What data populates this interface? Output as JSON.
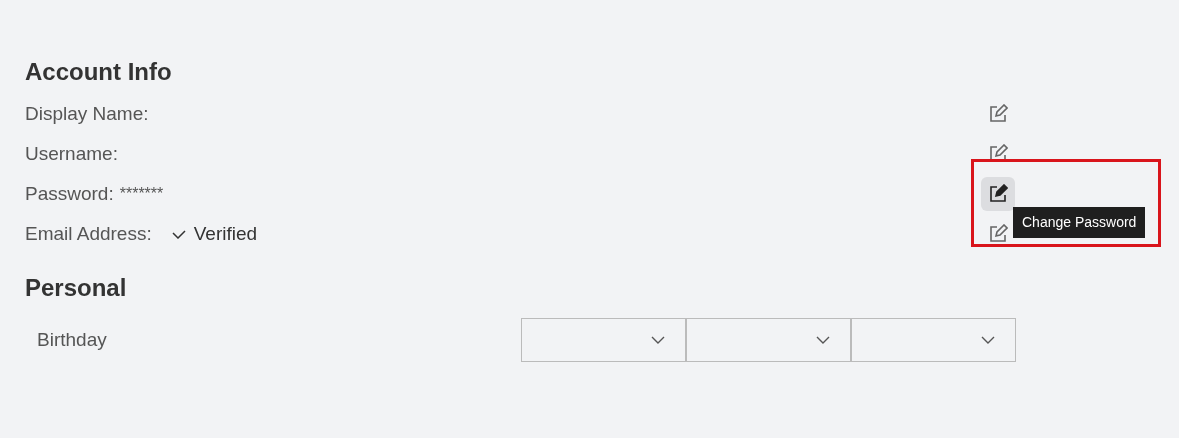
{
  "account_info": {
    "title": "Account Info",
    "rows": [
      {
        "label": "Display Name:",
        "hovered": false
      },
      {
        "label": "Username:",
        "hovered": false
      },
      {
        "label": "Password:",
        "value": "*******",
        "hovered": true
      },
      {
        "label": "Email Address:",
        "status": "Verified",
        "hovered": false
      }
    ],
    "tooltip": {
      "text": "Change Password"
    }
  },
  "personal": {
    "title": "Personal",
    "birthday": {
      "label": "Birthday",
      "dropdowns": [
        {
          "kind": "select"
        },
        {
          "kind": "select"
        },
        {
          "kind": "select"
        }
      ]
    }
  }
}
